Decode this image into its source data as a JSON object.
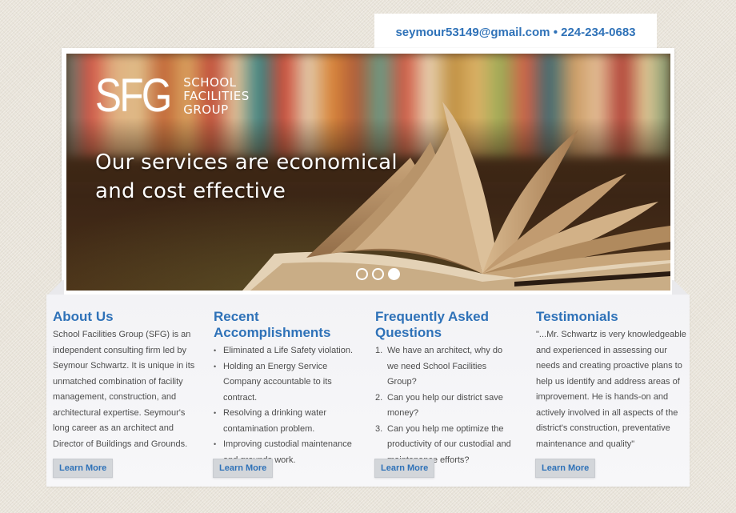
{
  "contact": {
    "email": "seymour53149@gmail.com",
    "separator": "•",
    "phone": "224-234-0683",
    "full": "seymour53149@gmail.com • 224-234-0683"
  },
  "hero": {
    "logo_mark": "SFG",
    "logo_lines": [
      "SCHOOL",
      "FACILITIES",
      "GROUP"
    ],
    "tagline_lines": [
      "Our services are economical",
      "and cost effective"
    ],
    "slides": {
      "count": 3,
      "active_index": 2
    }
  },
  "colors": {
    "accent": "#2f72b8",
    "body_text": "#4d4d4d",
    "button_bg": "#d3d6da"
  },
  "sections": {
    "about": {
      "title": "About Us",
      "body": "School Facilities Group (SFG) is an independent consulting firm led by Seymour Schwartz. It is unique in its unmatched combination of facility management, construction, and architectural expertise. Seymour's long career as an architect and Director of Buildings and Grounds.",
      "button": "Learn More"
    },
    "accomplishments": {
      "title": "Recent Accomplishments",
      "items": [
        "Eliminated a Life Safety violation.",
        "Holding an Energy Service Company accountable to its contract.",
        "Resolving a drinking water contamination problem.",
        "Improving custodial maintenance and grounds work."
      ],
      "button": "Learn More"
    },
    "faq": {
      "title": "Frequently Asked Questions",
      "items": [
        {
          "num": "1.",
          "text": "We have an architect, why do we need School Facilities Group?"
        },
        {
          "num": "2.",
          "text": "Can you help our district save money?"
        },
        {
          "num": "3.",
          "text": "Can you help me optimize the productivity of our custodial and maintenance efforts?"
        }
      ],
      "button": "Learn More"
    },
    "testimonials": {
      "title": "Testimonials",
      "body": "\"...Mr. Schwartz is very knowledgeable and experienced in assessing our needs and creating proactive plans to help us identify and address areas of improvement. He is hands-on and actively involved in all aspects of the district's construction, preventative maintenance and quality\"",
      "button": "Learn More"
    }
  }
}
